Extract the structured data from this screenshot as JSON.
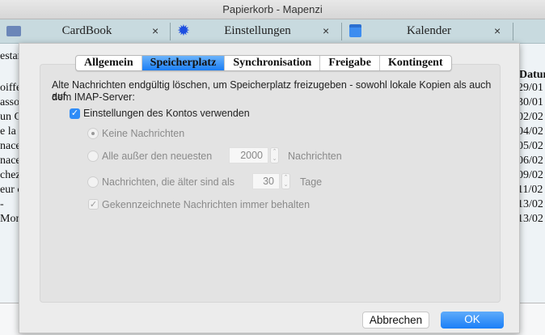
{
  "window": {
    "title": "Papierkorb - Mapenzi"
  },
  "app_tabs": [
    {
      "label": "CardBook",
      "icon": "contacts-icon",
      "close": "×"
    },
    {
      "label": "Einstellungen",
      "icon": "gear-icon",
      "close": "×"
    },
    {
      "label": "Kalender",
      "icon": "calendar-icon",
      "close": "×"
    }
  ],
  "background_list": {
    "left_header": "estar",
    "left_cells": [
      "oiffe",
      "asso",
      "un G",
      "e la p",
      "nace",
      "nace",
      "chez",
      "eur c",
      "-",
      "Mon"
    ],
    "right_header": "Datum",
    "right_cells": [
      "29/01",
      "30/01",
      "02/02",
      "04/02",
      "05/02",
      "06/02",
      "09/02",
      "11/02",
      "13/02",
      "13/02"
    ]
  },
  "dialog": {
    "tabs": [
      {
        "label": "Allgemein",
        "active": false
      },
      {
        "label": "Speicherplatz",
        "active": true
      },
      {
        "label": "Synchronisation",
        "active": false
      },
      {
        "label": "Freigabe",
        "active": false
      },
      {
        "label": "Kontingent",
        "active": false
      }
    ],
    "description_line1": "Alte Nachrichten endgültig löschen, um Speicherplatz freizugeben - sowohl lokale Kopien als auch auf",
    "description_line2": "dem IMAP-Server:",
    "use_account_settings": {
      "label": "Einstellungen des Kontos verwenden",
      "checked": true
    },
    "options": {
      "none": {
        "label": "Keine Nachrichten",
        "selected": true
      },
      "all_but_newest": {
        "label": "Alle außer den neuesten",
        "value": "2000",
        "suffix": "Nachrichten"
      },
      "older_than": {
        "label": "Nachrichten, die älter sind als",
        "value": "30",
        "suffix": "Tage"
      }
    },
    "keep_flagged": {
      "label": "Gekennzeichnete Nachrichten immer behalten",
      "checked": true
    },
    "cancel_label": "Abbrechen",
    "ok_label": "OK"
  }
}
